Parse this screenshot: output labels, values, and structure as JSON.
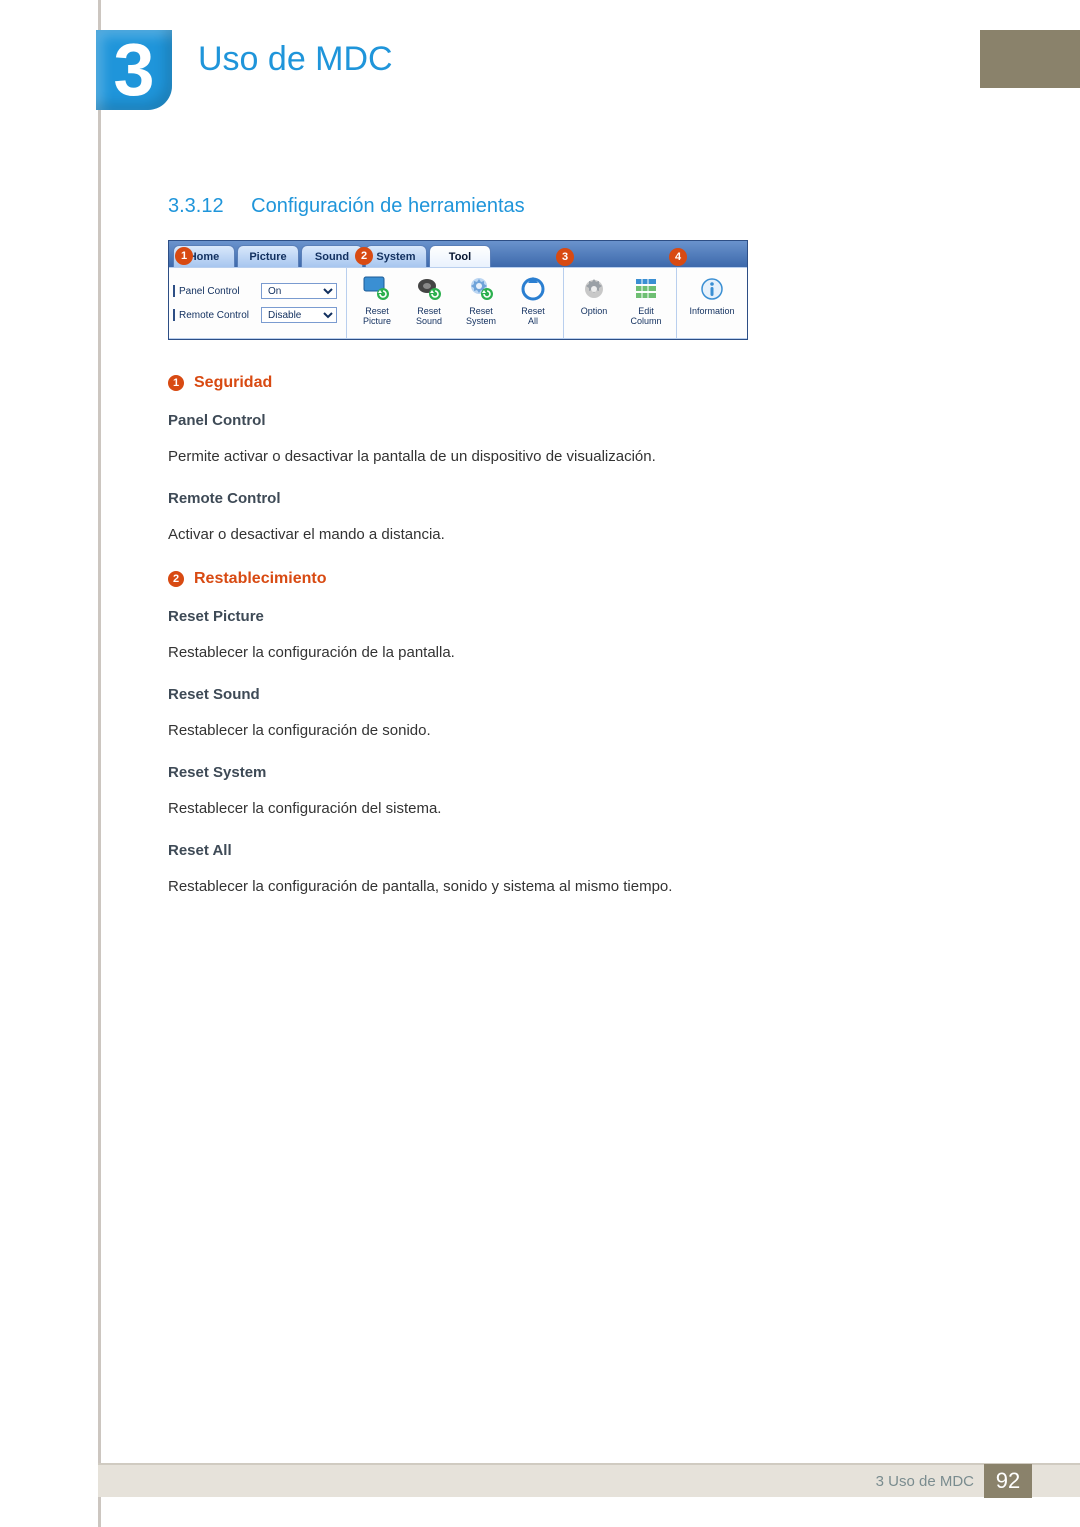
{
  "chapter": {
    "number": "3",
    "title": "Uso de MDC"
  },
  "section": {
    "number": "3.3.12",
    "title": "Configuración de herramientas"
  },
  "app": {
    "tabs": [
      "Home",
      "Picture",
      "Sound",
      "System",
      "Tool"
    ],
    "active_tab_index": 4,
    "panel": {
      "rows": [
        {
          "label": "Panel Control",
          "value": "On"
        },
        {
          "label": "Remote Control",
          "value": "Disable"
        }
      ]
    },
    "toolbar": {
      "reset_picture": "Reset\nPicture",
      "reset_sound": "Reset\nSound",
      "reset_system": "Reset\nSystem",
      "reset_all": "Reset\nAll",
      "option": "Option",
      "edit_column": "Edit\nColumn",
      "information": "Information"
    },
    "callouts": [
      "1",
      "2",
      "3",
      "4"
    ]
  },
  "sub1": {
    "badge": "1",
    "title": "Seguridad",
    "items": [
      {
        "name": "Panel Control",
        "desc": "Permite activar o desactivar la pantalla de un dispositivo de visualización."
      },
      {
        "name": "Remote Control",
        "desc": "Activar o desactivar el mando a distancia."
      }
    ]
  },
  "sub2": {
    "badge": "2",
    "title": "Restablecimiento",
    "items": [
      {
        "name": "Reset Picture",
        "desc": "Restablecer la configuración de la pantalla."
      },
      {
        "name": "Reset Sound",
        "desc": "Restablecer la configuración de sonido."
      },
      {
        "name": "Reset System",
        "desc": "Restablecer la configuración del sistema."
      },
      {
        "name": "Reset All",
        "desc": "Restablecer la configuración de pantalla, sonido y sistema al mismo tiempo."
      }
    ]
  },
  "footer": {
    "text": "3 Uso de MDC",
    "page": "92"
  }
}
